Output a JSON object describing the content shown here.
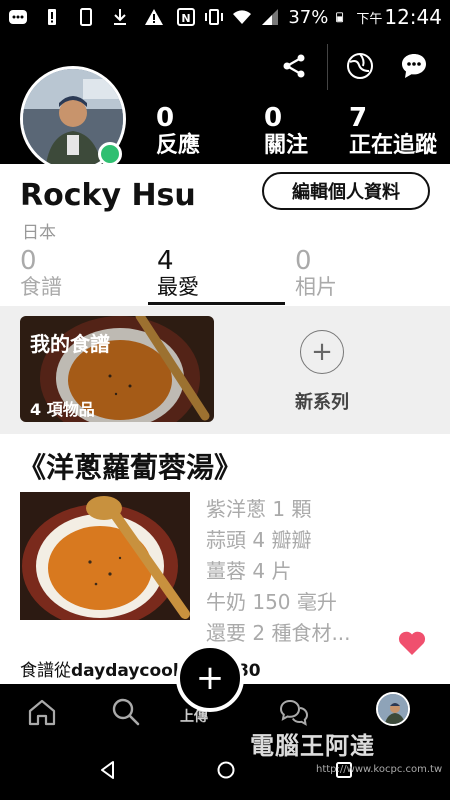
{
  "status_bar": {
    "battery": "37%",
    "time_prefix": "下午",
    "time": "12:44"
  },
  "header": {
    "stats": [
      {
        "value": "0",
        "label": "反應"
      },
      {
        "value": "0",
        "label": "關注"
      },
      {
        "value": "7",
        "label": "正在追蹤"
      }
    ],
    "icons": [
      "share-icon",
      "globe-icon",
      "chat-icon"
    ]
  },
  "profile": {
    "name": "Rocky Hsu",
    "location": "日本",
    "edit_button": "編輯個人資料",
    "tabs": [
      {
        "value": "0",
        "label": "食譜"
      },
      {
        "value": "4",
        "label": "最愛"
      },
      {
        "value": "0",
        "label": "相片"
      }
    ],
    "active_tab": "最愛"
  },
  "collections": {
    "card_title": "我的食譜",
    "card_count": "4 項物品",
    "new_series_label": "新系列"
  },
  "recipe": {
    "title": "《洋蔥蘿蔔蓉湯》",
    "ingredients": [
      "紫洋蔥 1 顆",
      "蒜頭 4 瓣瓣",
      "薑蓉 4 片",
      "牛奶 150 毫升",
      "還要 2 種食材..."
    ],
    "source_prefix": "食譜從",
    "source_site": "daydaycook.com:80"
  },
  "bottom_nav": {
    "fab_label": "+",
    "fab_caption": "上傳",
    "items": [
      "home-icon",
      "search-icon",
      "fab",
      "chat-bubbles-icon",
      "profile-avatar"
    ]
  },
  "watermark": {
    "text": "電腦王阿達",
    "url": "http://www.kocpc.com.tw"
  },
  "colors": {
    "online": "#2fbf71",
    "heart": "#f0506e",
    "header_bg": "#000000"
  }
}
